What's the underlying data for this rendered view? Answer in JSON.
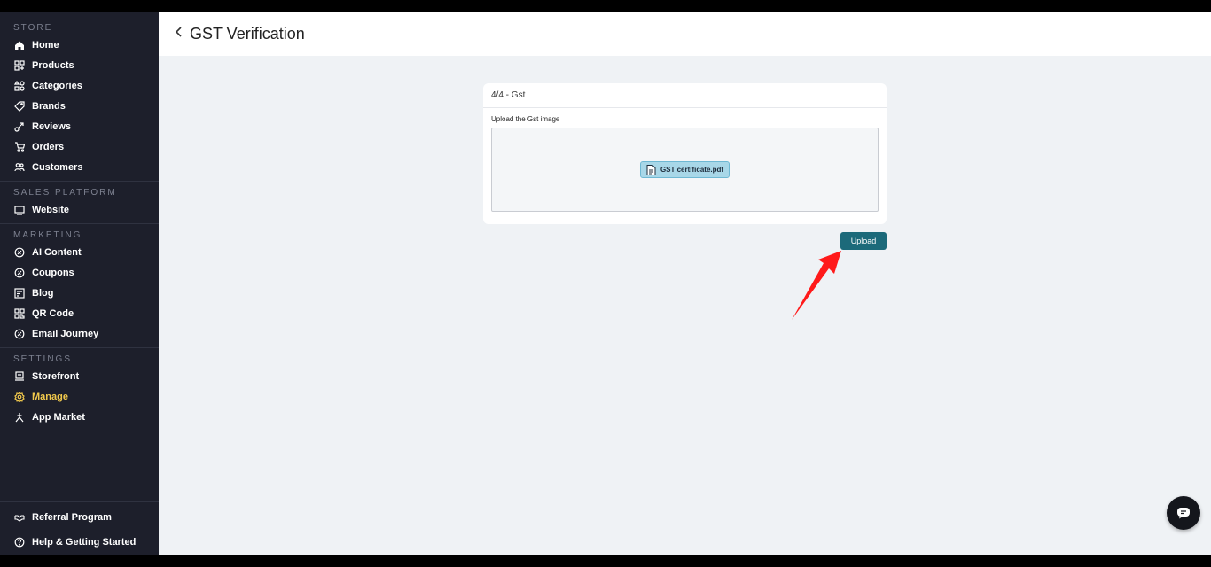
{
  "sidebar": {
    "sections": {
      "store": "STORE",
      "sales_platform": "SALES PLATFORM",
      "marketing": "MARKETING",
      "settings": "SETTINGS"
    },
    "store_items": [
      {
        "label": "Home",
        "icon": "home-icon"
      },
      {
        "label": "Products",
        "icon": "products-icon"
      },
      {
        "label": "Categories",
        "icon": "categories-icon"
      },
      {
        "label": "Brands",
        "icon": "tag-icon"
      },
      {
        "label": "Reviews",
        "icon": "reviews-icon"
      },
      {
        "label": "Orders",
        "icon": "cart-icon"
      },
      {
        "label": "Customers",
        "icon": "users-icon"
      }
    ],
    "sales_items": [
      {
        "label": "Website",
        "icon": "monitor-icon"
      }
    ],
    "marketing_items": [
      {
        "label": "AI Content",
        "icon": "badge-icon"
      },
      {
        "label": "Coupons",
        "icon": "coupon-icon"
      },
      {
        "label": "Blog",
        "icon": "blog-icon"
      },
      {
        "label": "QR Code",
        "icon": "qr-icon"
      },
      {
        "label": "Email Journey",
        "icon": "email-journey-icon"
      }
    ],
    "settings_items": [
      {
        "label": "Storefront",
        "icon": "storefront-icon"
      },
      {
        "label": "Manage",
        "icon": "gear-icon",
        "active": true
      },
      {
        "label": "App Market",
        "icon": "app-market-icon"
      }
    ],
    "bottom_items": [
      {
        "label": "Referral Program",
        "icon": "handshake-icon"
      },
      {
        "label": "Help & Getting Started",
        "icon": "help-icon"
      }
    ]
  },
  "header": {
    "back_icon": "chevron-left-icon",
    "title": "GST Verification"
  },
  "card": {
    "step": "4/4 - Gst",
    "field_label": "Upload the Gst image",
    "file_name": "GST certificate.pdf",
    "file_icon": "pdf-file-icon"
  },
  "actions": {
    "upload_label": "Upload"
  },
  "colors": {
    "sidebar_bg": "#1d1f2b",
    "active": "#f2c94c",
    "primary_button": "#1c6a7a",
    "chip_bg": "#a8d7e8",
    "annotation_arrow": "#ff1a1a"
  }
}
